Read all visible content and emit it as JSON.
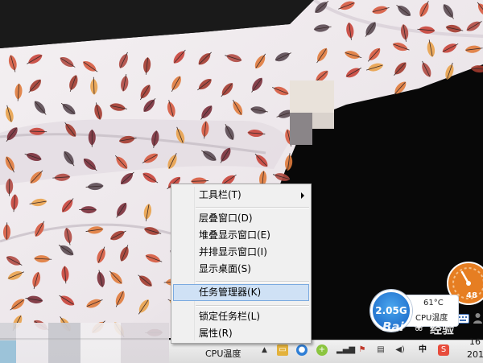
{
  "context_menu": {
    "items": [
      {
        "label": "工具栏(T)",
        "has_submenu": true
      },
      {
        "label": "层叠窗口(D)"
      },
      {
        "label": "堆叠显示窗口(E)"
      },
      {
        "label": "并排显示窗口(I)"
      },
      {
        "label": "显示桌面(S)"
      },
      {
        "label": "任务管理器(K)",
        "selected": true
      },
      {
        "label": "锁定任务栏(L)"
      },
      {
        "label": "属性(R)"
      }
    ]
  },
  "widgets": {
    "memory_value": "2.05G",
    "cpu_temp": "61°C",
    "cpu_temp_label": "CPU温度",
    "gauge_value": "48"
  },
  "taskbar": {
    "cpu_label": "CPU温度",
    "clock_time": "16",
    "clock_year": "201"
  },
  "watermark": {
    "text": "经验"
  },
  "colors": {
    "menu_bg": "#f0f0f0",
    "menu_highlight": "#cfe1f5",
    "memory_ball": "#1d74d3",
    "gauge": "#e67e22"
  }
}
